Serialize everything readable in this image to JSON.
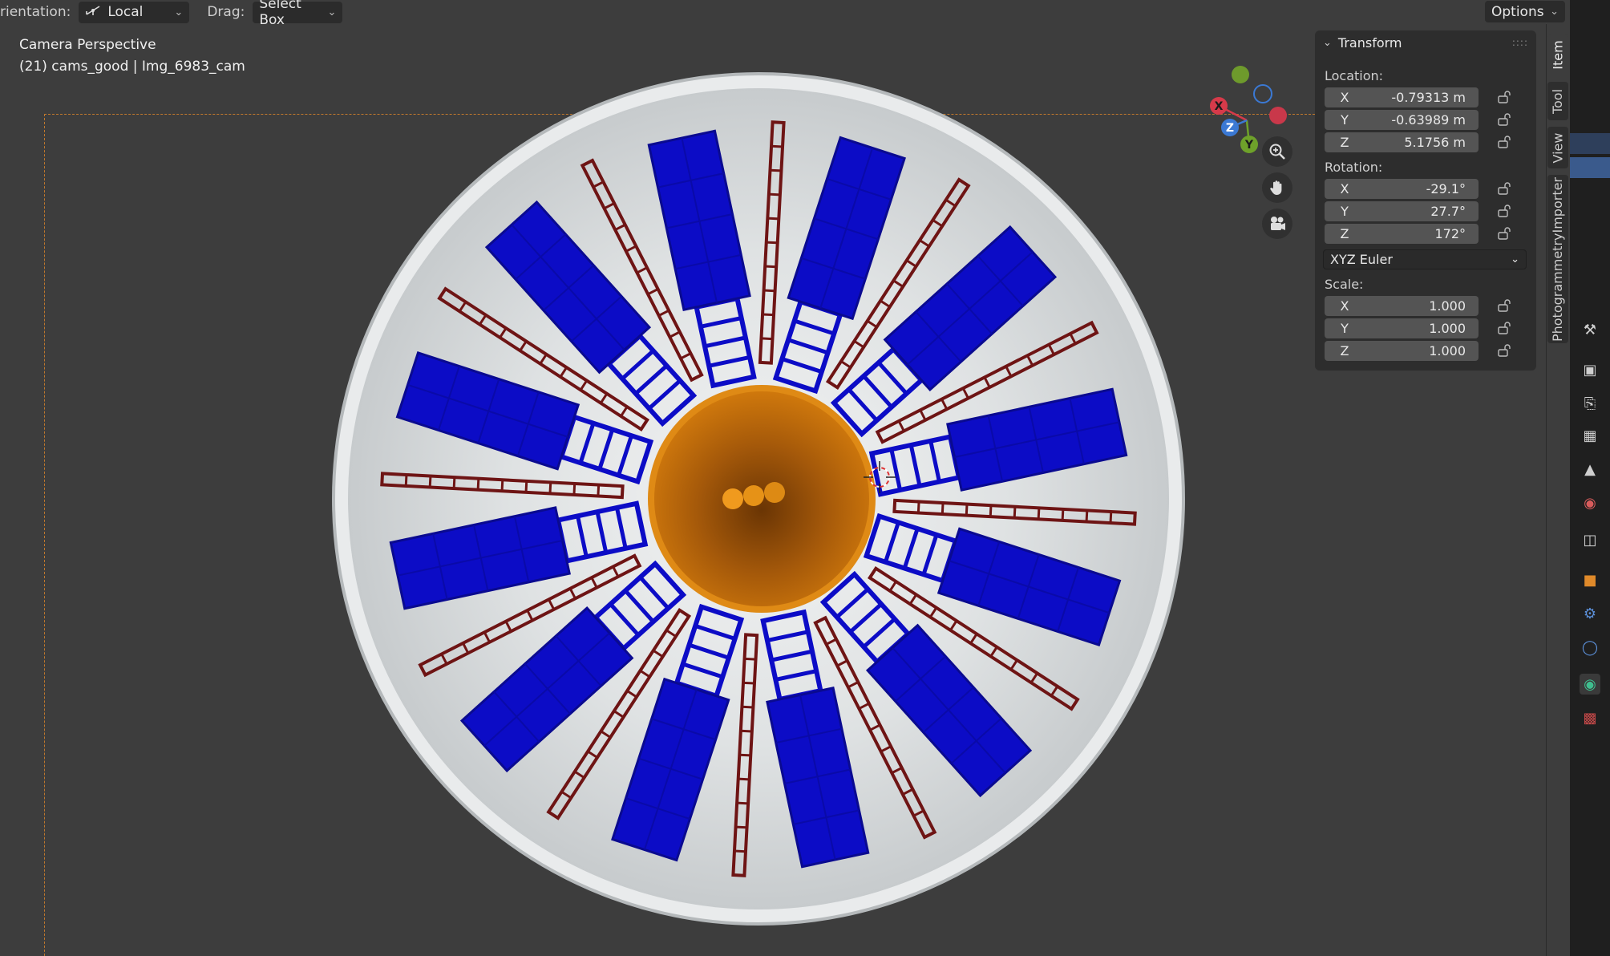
{
  "header": {
    "orientation_label": "rientation:",
    "orientation_value": "Local",
    "drag_label": "Drag:",
    "drag_value": "Select Box",
    "options_label": "Options"
  },
  "viewport": {
    "mode_title": "Camera Perspective",
    "object_info": "(21) cams_good | Img_6983_cam"
  },
  "gizmo": {
    "x": "X",
    "y": "Y",
    "z": "Z"
  },
  "nav_icons": [
    "zoom-icon",
    "hand-pan-icon",
    "camera-view-icon"
  ],
  "transform": {
    "panel_title": "Transform",
    "location_label": "Location:",
    "location": [
      {
        "axis": "X",
        "value": "-0.79313 m"
      },
      {
        "axis": "Y",
        "value": "-0.63989 m"
      },
      {
        "axis": "Z",
        "value": "5.1756 m"
      }
    ],
    "rotation_label": "Rotation:",
    "rotation": [
      {
        "axis": "X",
        "value": "-29.1°"
      },
      {
        "axis": "Y",
        "value": "27.7°"
      },
      {
        "axis": "Z",
        "value": "172°"
      }
    ],
    "rotation_mode": "XYZ Euler",
    "scale_label": "Scale:",
    "scale": [
      {
        "axis": "X",
        "value": "1.000"
      },
      {
        "axis": "Y",
        "value": "1.000"
      },
      {
        "axis": "Z",
        "value": "1.000"
      }
    ]
  },
  "sidebar_tabs": [
    "Item",
    "Tool",
    "View",
    "PhotogrammetryImporter"
  ],
  "property_icons": [
    "tool-icon",
    "render-icon",
    "output-icon",
    "view-layer-icon",
    "scene-icon",
    "world-icon",
    "collection-icon",
    "object-icon",
    "modifier-icon",
    "physics-icon",
    "object-data-camera-icon",
    "texture-icon"
  ],
  "colors": {
    "viewport_bg": "#3d3d3d",
    "dome": "#d9dcde",
    "panel_blue": "#0c0cc6",
    "ladder_red": "#6e1414",
    "center_orange": "#c56e07",
    "selection_orange": "#e07b1a"
  }
}
